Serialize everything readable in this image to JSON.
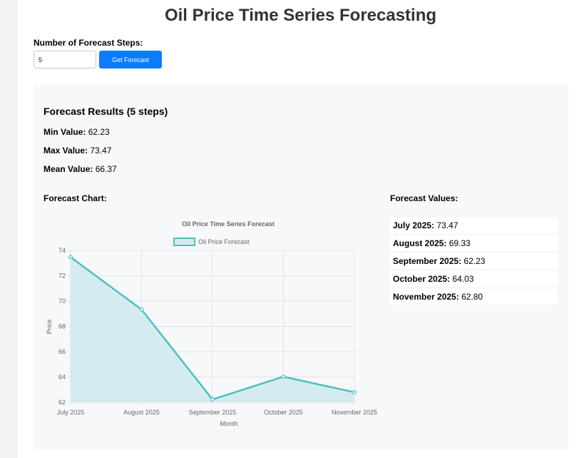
{
  "page": {
    "title": "Oil Price Time Series Forecasting"
  },
  "controls": {
    "steps_label": "Number of Forecast Steps:",
    "steps_value": "5",
    "button_label": "Get Forecast",
    "accent_color": "#0a7cff"
  },
  "results": {
    "heading": "Forecast Results (5 steps)",
    "min_label": "Min Value:",
    "min_value": "62.23",
    "max_label": "Max Value:",
    "max_value": "73.47",
    "mean_label": "Mean Value:",
    "mean_value": "66.37",
    "chart_heading": "Forecast Chart:",
    "values_heading": "Forecast Values:",
    "values": [
      {
        "month": "July 2025:",
        "value": "73.47"
      },
      {
        "month": "August 2025:",
        "value": "69.33"
      },
      {
        "month": "September 2025:",
        "value": "62.23"
      },
      {
        "month": "October 2025:",
        "value": "64.03"
      },
      {
        "month": "November 2025:",
        "value": "62.80"
      }
    ]
  },
  "chart_data": {
    "type": "line",
    "title": "Oil Price Time Series Forecast",
    "xlabel": "Month",
    "ylabel": "Price",
    "categories": [
      "July 2025",
      "August 2025",
      "September 2025",
      "October 2025",
      "November 2025"
    ],
    "series": [
      {
        "name": "Oil Price Forecast",
        "values": [
          73.47,
          69.33,
          62.23,
          64.03,
          62.8
        ]
      }
    ],
    "ylim": [
      62,
      74
    ],
    "yticks": [
      62,
      64,
      66,
      68,
      70,
      72,
      74
    ],
    "grid": true,
    "legend": "top",
    "filled": true,
    "line_color": "#4bc0c0",
    "fill_color": "#d4ecef"
  }
}
